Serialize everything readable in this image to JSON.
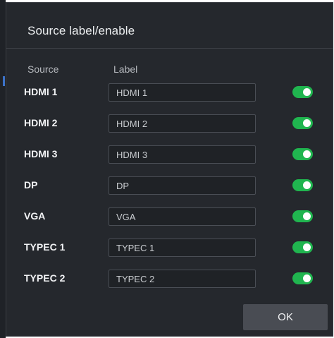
{
  "dialog": {
    "title": "Source label/enable",
    "ok_label": "OK"
  },
  "columns": {
    "source": "Source",
    "label": "Label"
  },
  "sources": [
    {
      "name": "HDMI 1",
      "label_value": "HDMI 1",
      "enabled": true
    },
    {
      "name": "HDMI 2",
      "label_value": "HDMI 2",
      "enabled": true
    },
    {
      "name": "HDMI 3",
      "label_value": "HDMI 3",
      "enabled": true
    },
    {
      "name": "DP",
      "label_value": "DP",
      "enabled": true
    },
    {
      "name": "VGA",
      "label_value": "VGA",
      "enabled": true
    },
    {
      "name": "TYPEC 1",
      "label_value": "TYPEC 1",
      "enabled": true
    },
    {
      "name": "TYPEC 2",
      "label_value": "TYPEC 2",
      "enabled": true
    }
  ],
  "colors": {
    "toggle_on": "#20b54f",
    "dialog_background": "#25282d",
    "ok_button": "#494c53"
  }
}
